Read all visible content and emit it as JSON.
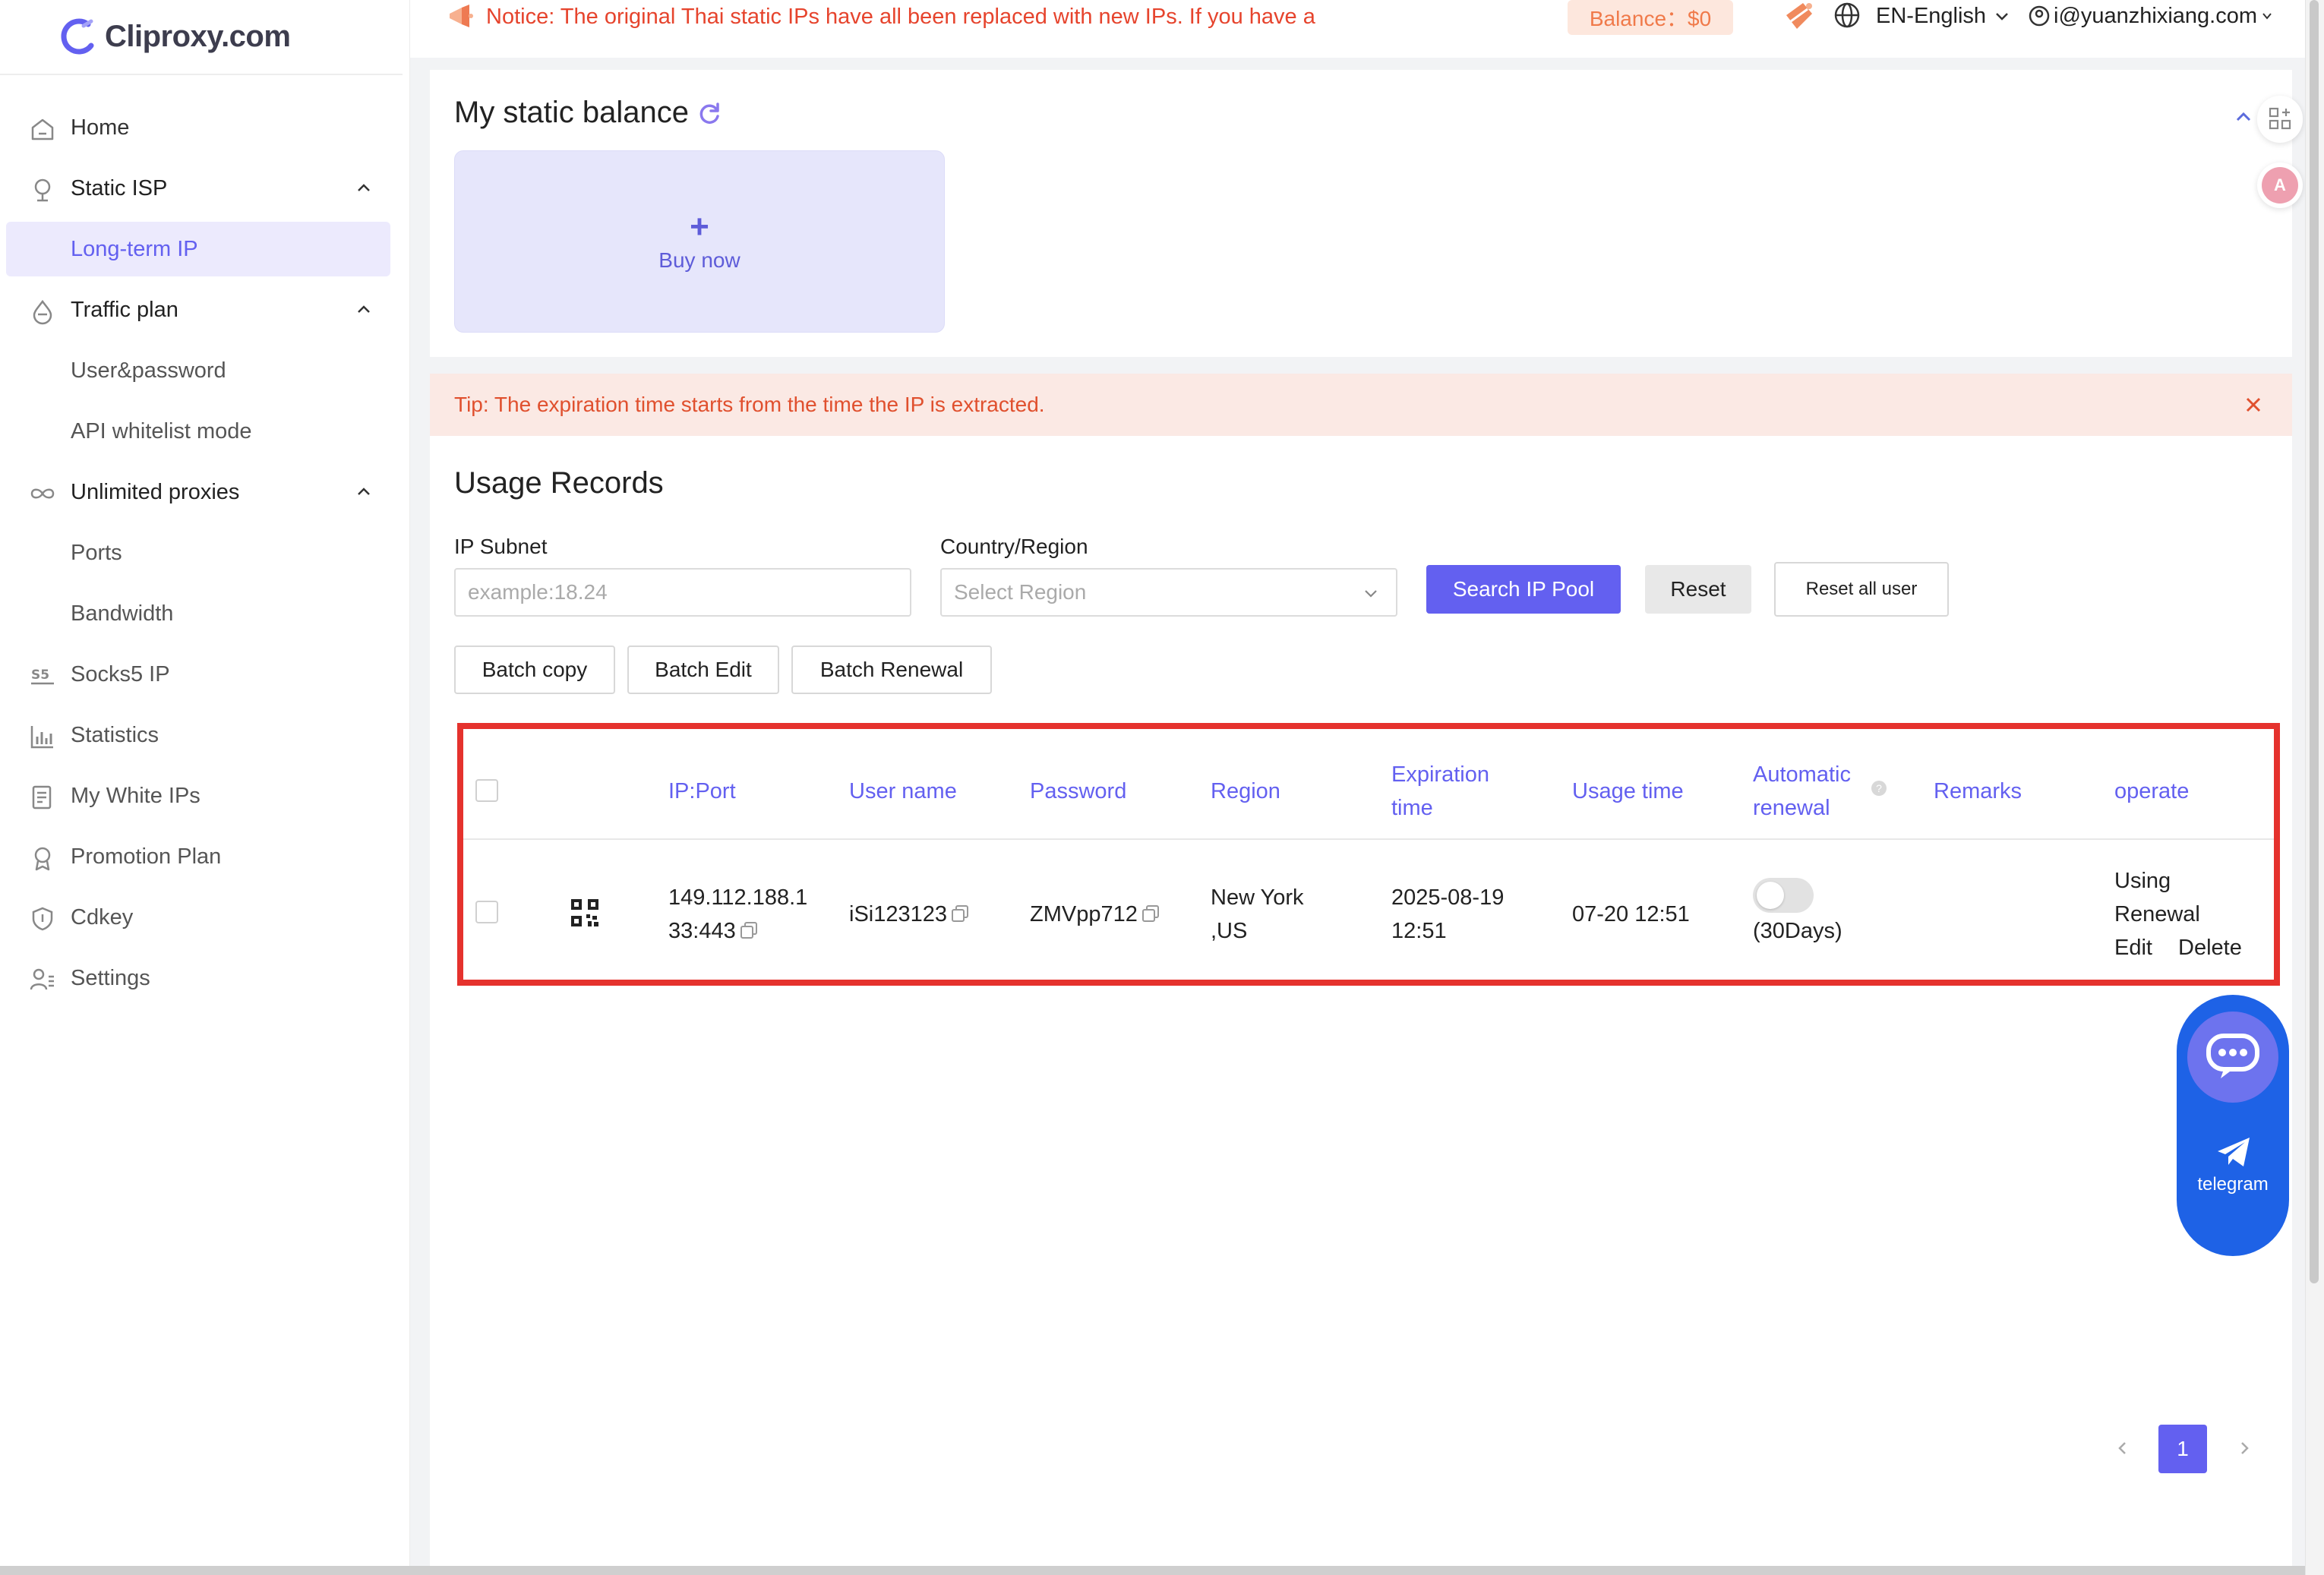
{
  "brand": {
    "name": "Cliproxy.com",
    "accent": "#6360f0",
    "danger": "#e5322d"
  },
  "sidebar": {
    "items": [
      {
        "label": "Home",
        "icon": "home-icon"
      },
      {
        "label": "Static ISP",
        "icon": "location-pin-icon"
      },
      {
        "label": "Long-term IP"
      },
      {
        "label": "Traffic plan",
        "icon": "drop-icon"
      },
      {
        "label": "User&password"
      },
      {
        "label": "API whitelist mode"
      },
      {
        "label": "Unlimited proxies",
        "icon": "infinity-icon"
      },
      {
        "label": "Ports"
      },
      {
        "label": "Bandwidth"
      },
      {
        "label": "Socks5 IP",
        "icon": "s5-icon"
      },
      {
        "label": "Statistics",
        "icon": "bar-chart-icon"
      },
      {
        "label": "My White IPs",
        "icon": "document-icon"
      },
      {
        "label": "Promotion Plan",
        "icon": "award-icon"
      },
      {
        "label": "Cdkey",
        "icon": "shield-icon"
      },
      {
        "label": "Settings",
        "icon": "user-settings-icon"
      }
    ]
  },
  "topbar": {
    "notice": "Notice: The original Thai static IPs have all been replaced with new IPs. If you have a",
    "balance": "Balance：$0",
    "language": "EN-English",
    "user": "i@yuanzhixiang.com"
  },
  "balance_card": {
    "title": "My static balance",
    "buy_plus": "+",
    "buy_label": "Buy now"
  },
  "tip": "Tip: The expiration time starts from the time the IP is extracted.",
  "usage": {
    "title": "Usage Records",
    "filters": {
      "subnet_label": "IP Subnet",
      "subnet_placeholder": "example:18.24",
      "region_label": "Country/Region",
      "region_placeholder": "Select Region"
    },
    "buttons": {
      "search": "Search IP Pool",
      "reset": "Reset",
      "reset_all": "Reset all user",
      "batch_copy": "Batch copy",
      "batch_edit": "Batch Edit",
      "batch_renewal": "Batch Renewal"
    },
    "columns": {
      "ip_port": "IP:Port",
      "user_name": "User name",
      "password": "Password",
      "region": "Region",
      "expiration_l1": "Expiration",
      "expiration_l2": "time",
      "usage_time": "Usage time",
      "auto_l1": "Automatic",
      "auto_l2": "renewal",
      "remarks": "Remarks",
      "operate": "operate"
    },
    "rows": [
      {
        "ip_l1": "149.112.188.1",
        "ip_l2": "33:443",
        "user_name": "iSi123123",
        "password": "ZMVpp712",
        "region_l1": "New York",
        "region_l2": ",US",
        "exp_l1": "2025-08-19",
        "exp_l2": "12:51",
        "usage_time": "07-20 12:51",
        "auto_renew_on": false,
        "auto_renew_days": "(30Days)",
        "remarks": "",
        "op_using": "Using",
        "op_renewal": "Renewal",
        "op_edit": "Edit",
        "op_delete": "Delete"
      }
    ]
  },
  "pagination": {
    "current": "1"
  },
  "float": {
    "telegram_label": "telegram"
  }
}
